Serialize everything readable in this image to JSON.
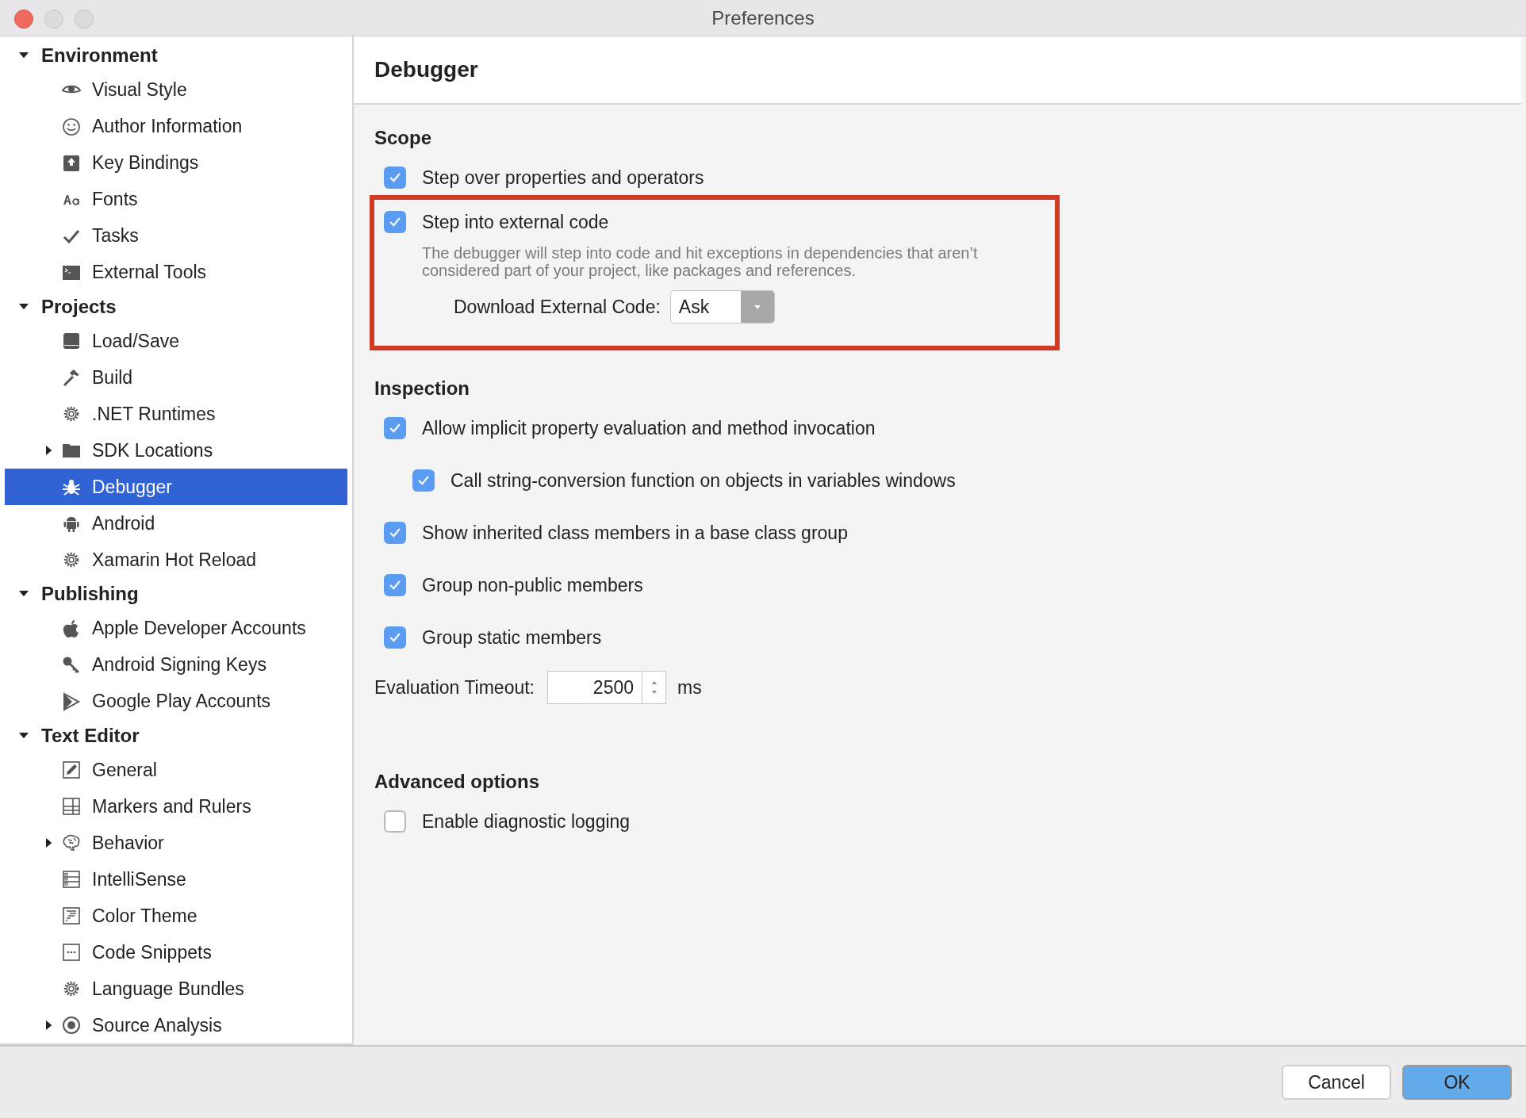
{
  "window": {
    "title": "Preferences"
  },
  "sidebar": {
    "items": [
      {
        "kind": "group",
        "label": "Environment",
        "expanded": true,
        "children": [
          {
            "kind": "page",
            "label": "Visual Style",
            "selected": false
          },
          {
            "kind": "page",
            "label": "Author Information",
            "selected": false
          },
          {
            "kind": "page",
            "label": "Key Bindings",
            "selected": false
          },
          {
            "kind": "page",
            "label": "Fonts",
            "selected": false
          },
          {
            "kind": "page",
            "label": "Tasks",
            "selected": false
          },
          {
            "kind": "page",
            "label": "External Tools",
            "selected": false
          }
        ]
      },
      {
        "kind": "group",
        "label": "Projects",
        "expanded": true,
        "children": [
          {
            "kind": "page",
            "label": "Load/Save",
            "selected": false
          },
          {
            "kind": "page",
            "label": "Build",
            "selected": false
          },
          {
            "kind": "page",
            "label": ".NET Runtimes",
            "selected": false
          },
          {
            "kind": "page",
            "label": "SDK Locations",
            "selected": false,
            "expanded": false
          },
          {
            "kind": "page",
            "label": "Debugger",
            "selected": true
          },
          {
            "kind": "page",
            "label": "Android",
            "selected": false
          },
          {
            "kind": "page",
            "label": "Xamarin Hot Reload",
            "selected": false
          }
        ]
      },
      {
        "kind": "group",
        "label": "Publishing",
        "expanded": true,
        "children": [
          {
            "kind": "page",
            "label": "Apple Developer Accounts",
            "selected": false
          },
          {
            "kind": "page",
            "label": "Android Signing Keys",
            "selected": false
          },
          {
            "kind": "page",
            "label": "Google Play Accounts",
            "selected": false
          }
        ]
      },
      {
        "kind": "group",
        "label": "Text Editor",
        "expanded": true,
        "children": [
          {
            "kind": "page",
            "label": "General",
            "selected": false
          },
          {
            "kind": "page",
            "label": "Markers and Rulers",
            "selected": false
          },
          {
            "kind": "page",
            "label": "Behavior",
            "selected": false,
            "expanded": false
          },
          {
            "kind": "page",
            "label": "IntelliSense",
            "selected": false
          },
          {
            "kind": "page",
            "label": "Color Theme",
            "selected": false
          },
          {
            "kind": "page",
            "label": "Code Snippets",
            "selected": false
          },
          {
            "kind": "page",
            "label": "Language Bundles",
            "selected": false
          },
          {
            "kind": "page",
            "label": "Source Analysis",
            "selected": false,
            "expanded": false
          }
        ]
      }
    ]
  },
  "panel": {
    "title": "Debugger",
    "sections": [
      {
        "heading": "Scope",
        "options": [
          {
            "label": "Step over properties and operators",
            "checked": true
          },
          {
            "label": "Step into external code",
            "checked": true,
            "highlighted": true,
            "description": "The debugger will step into code and hit exceptions in dependencies that aren’t considered part of your project, like packages and references.",
            "dropdown": {
              "label": "Download External Code:",
              "value": "Ask"
            }
          }
        ]
      },
      {
        "heading": "Inspection",
        "options": [
          {
            "label": "Allow implicit property evaluation and method invocation",
            "checked": true,
            "children": [
              {
                "label": "Call string-conversion function on objects in variables windows",
                "checked": true
              }
            ]
          },
          {
            "label": "Show inherited class members in a base class group",
            "checked": true
          },
          {
            "label": "Group non-public members",
            "checked": true
          },
          {
            "label": "Group static members",
            "checked": true
          }
        ],
        "spinner": {
          "label": "Evaluation Timeout:",
          "value": "2500",
          "unit": "ms"
        }
      },
      {
        "heading": "Advanced options",
        "options": [
          {
            "label": "Enable diagnostic logging",
            "checked": false
          }
        ]
      }
    ]
  },
  "buttons": [
    {
      "label": "Cancel",
      "kind": "secondary"
    },
    {
      "label": "OK",
      "kind": "primary"
    }
  ]
}
